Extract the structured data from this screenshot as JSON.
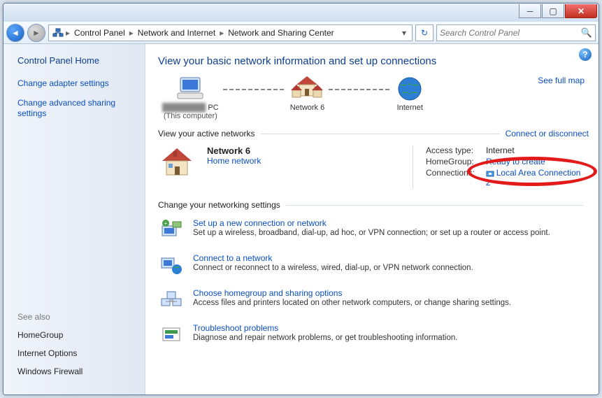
{
  "breadcrumb": {
    "items": [
      "Control Panel",
      "Network and Internet",
      "Network and Sharing Center"
    ]
  },
  "search": {
    "placeholder": "Search Control Panel"
  },
  "sidebar": {
    "home": "Control Panel Home",
    "links": [
      "Change adapter settings",
      "Change advanced sharing settings"
    ],
    "see_also_h": "See also",
    "see_also": [
      "HomeGroup",
      "Internet Options",
      "Windows Firewall"
    ]
  },
  "main": {
    "title": "View your basic network information and set up connections",
    "full_map": "See full map",
    "nodes": {
      "pc_name": "PC",
      "pc_sub": "(This computer)",
      "net_name": "Network  6",
      "inet": "Internet"
    },
    "active_h": "View your active networks",
    "connect_link": "Connect or disconnect",
    "network": {
      "name": "Network  6",
      "type": "Home network",
      "access_k": "Access type:",
      "access_v": "Internet",
      "hg_k": "HomeGroup:",
      "hg_v": "Ready to create",
      "conn_k": "Connections:",
      "conn_v": "Local Area Connection 2"
    },
    "settings_h": "Change your networking settings",
    "items": [
      {
        "t": "Set up a new connection or network",
        "d": "Set up a wireless, broadband, dial-up, ad hoc, or VPN connection; or set up a router or access point."
      },
      {
        "t": "Connect to a network",
        "d": "Connect or reconnect to a wireless, wired, dial-up, or VPN network connection."
      },
      {
        "t": "Choose homegroup and sharing options",
        "d": "Access files and printers located on other network computers, or change sharing settings."
      },
      {
        "t": "Troubleshoot problems",
        "d": "Diagnose and repair network problems, or get troubleshooting information."
      }
    ]
  }
}
